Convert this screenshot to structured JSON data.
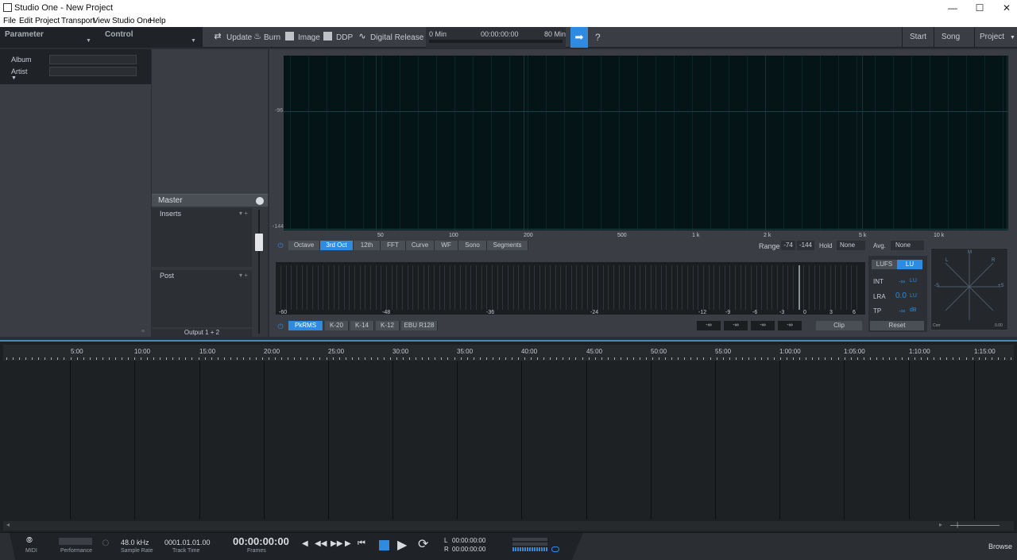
{
  "window": {
    "title": "Studio One - New Project",
    "minimize": "—",
    "maximize": "☐",
    "close": "✕"
  },
  "menu": [
    "File",
    "Edit",
    "Project",
    "Transport",
    "View",
    "Studio One",
    "Help"
  ],
  "toolbar": {
    "parameter_label": "Parameter",
    "control_label": "Control",
    "update": "Update",
    "burn": "Burn",
    "image": "Image",
    "ddp": "DDP",
    "digital_release": "Digital Release",
    "time_start": "0 Min",
    "time_pos": "00:00:00:00",
    "time_end": "80 Min",
    "help": "?",
    "nav": {
      "start": "Start",
      "song": "Song",
      "project": "Project"
    }
  },
  "metadata": {
    "album_label": "Album",
    "artist_label": "Artist"
  },
  "master": {
    "title": "Master",
    "inserts": "Inserts",
    "post": "Post",
    "output": "Output 1 + 2"
  },
  "analyzer": {
    "db_labels": [
      "-96",
      "-144"
    ],
    "freq_labels": [
      "50",
      "100",
      "200",
      "500",
      "1 k",
      "2 k",
      "5 k",
      "10 k"
    ],
    "modes": [
      "Octave",
      "3rd Oct",
      "12th",
      "FFT",
      "Curve",
      "WF",
      "Sono",
      "Segments"
    ],
    "active_mode": "3rd Oct",
    "range_label": "Range",
    "range_low": "-74",
    "range_high": "-144",
    "hold_label": "Hold",
    "hold_value": "None",
    "avg_label": "Avg.",
    "avg_value": "None"
  },
  "meter": {
    "scale": [
      "-60",
      "-48",
      "-36",
      "-24",
      "-12",
      "-9",
      "-6",
      "-3",
      "0",
      "3",
      "6"
    ],
    "modes": [
      "PkRMS",
      "K-20",
      "K-14",
      "K-12",
      "EBU R128"
    ],
    "active_mode": "PkRMS",
    "readouts": [
      "-∞",
      "-∞",
      "-∞",
      "-∞"
    ],
    "clip": "Clip"
  },
  "loudness": {
    "tabs": [
      "LUFS",
      "LU"
    ],
    "active_tab": "LU",
    "int_label": "INT",
    "int_value": "-∞",
    "int_unit": "LU",
    "lra_label": "LRA",
    "lra_value": "0.0",
    "lra_unit": "LU",
    "tp_label": "TP",
    "tp_value": "-∞",
    "tp_unit": "dB",
    "reset": "Reset"
  },
  "vectorscope": {
    "top": "M",
    "left": "L",
    "right": "R",
    "side_l": "-S",
    "side_r": "+S",
    "corr": "Corr",
    "corr_val": "0.00"
  },
  "timeline": {
    "labels": [
      "5:00",
      "10:00",
      "15:00",
      "20:00",
      "25:00",
      "30:00",
      "35:00",
      "40:00",
      "45:00",
      "50:00",
      "55:00",
      "1:00:00",
      "1:05:00",
      "1:10:00",
      "1:15:00"
    ]
  },
  "transport": {
    "midi": "MIDI",
    "performance": "Performance",
    "sample_rate_value": "48.0 kHz",
    "sample_rate_label": "Sample Rate",
    "track_time_value": "0001.01.01.00",
    "track_time_label": "Track Time",
    "frames_value": "00:00:00:00",
    "frames_label": "Frames",
    "l_label": "L",
    "l_value": "00:00:00:00",
    "r_label": "R",
    "r_value": "00:00:00:00",
    "browse": "Browse"
  },
  "colors": {
    "accent": "#2e8be0",
    "bg": "#2b2e33",
    "spectrum_bg": "#041417"
  }
}
